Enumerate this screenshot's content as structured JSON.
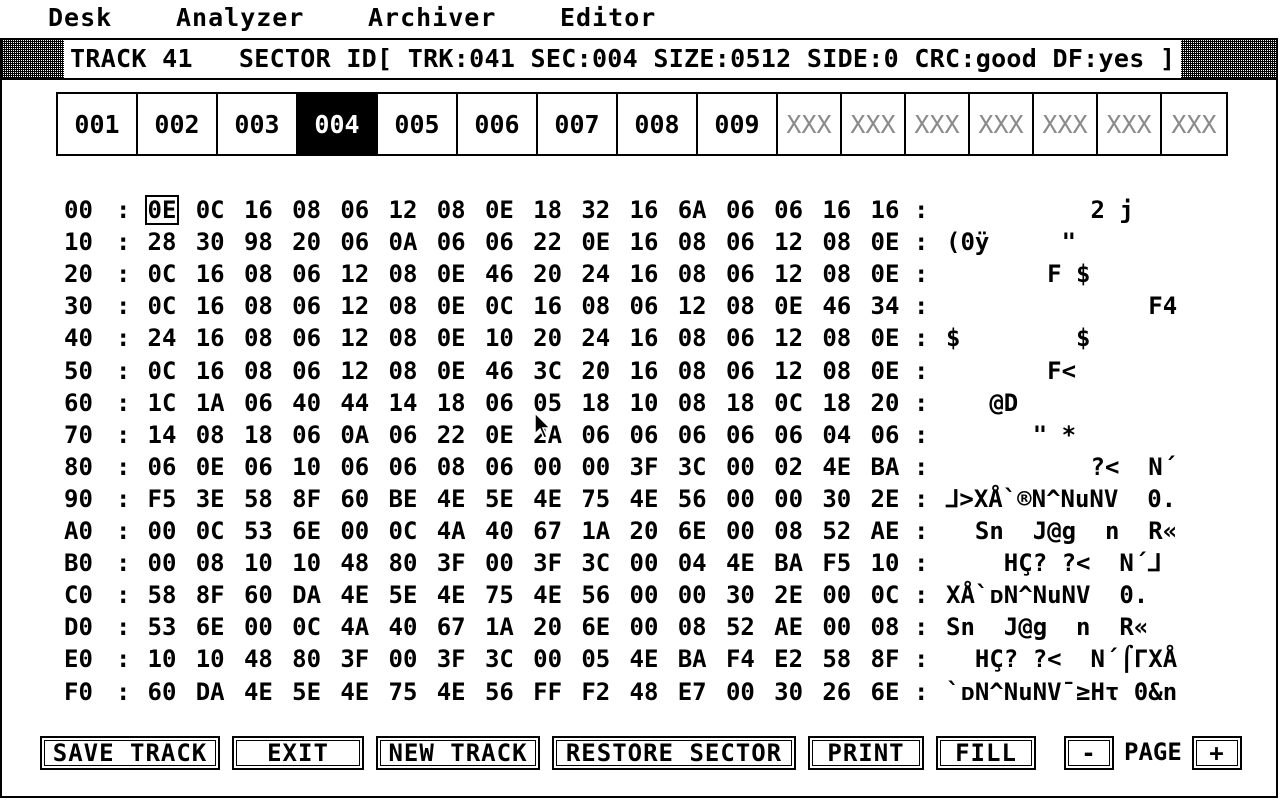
{
  "menubar": {
    "items": [
      "Desk",
      "Analyzer",
      "Archiver",
      "Editor"
    ]
  },
  "window": {
    "title": "TRACK 41   SECTOR ID[ TRK:041 SEC:004 SIZE:0512 SIDE:0 CRC:good DF:yes ]"
  },
  "sectors": {
    "selected": "004",
    "tabs": [
      "001",
      "002",
      "003",
      "004",
      "005",
      "006",
      "007",
      "008",
      "009",
      "XXX",
      "XXX",
      "XXX",
      "XXX",
      "XXX",
      "XXX",
      "XXX"
    ]
  },
  "dump": {
    "rows": [
      {
        "addr": "00",
        "bytes": [
          "0E",
          "0C",
          "16",
          "08",
          "06",
          "12",
          "08",
          "0E",
          "18",
          "32",
          "16",
          "6A",
          "06",
          "06",
          "16",
          "16"
        ],
        "ascii": "          2 j   "
      },
      {
        "addr": "10",
        "bytes": [
          "28",
          "30",
          "98",
          "20",
          "06",
          "0A",
          "06",
          "06",
          "22",
          "0E",
          "16",
          "08",
          "06",
          "12",
          "08",
          "0E"
        ],
        "ascii": "(0ÿ     \"       "
      },
      {
        "addr": "20",
        "bytes": [
          "0C",
          "16",
          "08",
          "06",
          "12",
          "08",
          "0E",
          "46",
          "20",
          "24",
          "16",
          "08",
          "06",
          "12",
          "08",
          "0E"
        ],
        "ascii": "       F $      "
      },
      {
        "addr": "30",
        "bytes": [
          "0C",
          "16",
          "08",
          "06",
          "12",
          "08",
          "0E",
          "0C",
          "16",
          "08",
          "06",
          "12",
          "08",
          "0E",
          "46",
          "34"
        ],
        "ascii": "              F4"
      },
      {
        "addr": "40",
        "bytes": [
          "24",
          "16",
          "08",
          "06",
          "12",
          "08",
          "0E",
          "10",
          "20",
          "24",
          "16",
          "08",
          "06",
          "12",
          "08",
          "0E"
        ],
        "ascii": "$        $      "
      },
      {
        "addr": "50",
        "bytes": [
          "0C",
          "16",
          "08",
          "06",
          "12",
          "08",
          "0E",
          "46",
          "3C",
          "20",
          "16",
          "08",
          "06",
          "12",
          "08",
          "0E"
        ],
        "ascii": "       F<       "
      },
      {
        "addr": "60",
        "bytes": [
          "1C",
          "1A",
          "06",
          "40",
          "44",
          "14",
          "18",
          "06",
          "05",
          "18",
          "10",
          "08",
          "18",
          "0C",
          "18",
          "20"
        ],
        "ascii": "   @D           "
      },
      {
        "addr": "70",
        "bytes": [
          "14",
          "08",
          "18",
          "06",
          "0A",
          "06",
          "22",
          "0E",
          "2A",
          "06",
          "06",
          "06",
          "06",
          "06",
          "04",
          "06"
        ],
        "ascii": "      \" *       "
      },
      {
        "addr": "80",
        "bytes": [
          "06",
          "0E",
          "06",
          "10",
          "06",
          "06",
          "08",
          "06",
          "00",
          "00",
          "3F",
          "3C",
          "00",
          "02",
          "4E",
          "BA"
        ],
        "ascii": "          ?<  N´"
      },
      {
        "addr": "90",
        "bytes": [
          "F5",
          "3E",
          "58",
          "8F",
          "60",
          "BE",
          "4E",
          "5E",
          "4E",
          "75",
          "4E",
          "56",
          "00",
          "00",
          "30",
          "2E"
        ],
        "ascii": "⅃>XÅ`®N^NuNV  0."
      },
      {
        "addr": "A0",
        "bytes": [
          "00",
          "0C",
          "53",
          "6E",
          "00",
          "0C",
          "4A",
          "40",
          "67",
          "1A",
          "20",
          "6E",
          "00",
          "08",
          "52",
          "AE"
        ],
        "ascii": "  Sn  J@g  n  R«"
      },
      {
        "addr": "B0",
        "bytes": [
          "00",
          "08",
          "10",
          "10",
          "48",
          "80",
          "3F",
          "00",
          "3F",
          "3C",
          "00",
          "04",
          "4E",
          "BA",
          "F5",
          "10"
        ],
        "ascii": "    HÇ? ?<  N´⅃ "
      },
      {
        "addr": "C0",
        "bytes": [
          "58",
          "8F",
          "60",
          "DA",
          "4E",
          "5E",
          "4E",
          "75",
          "4E",
          "56",
          "00",
          "00",
          "30",
          "2E",
          "00",
          "0C"
        ],
        "ascii": "XÅ`ᴅN^NuNV  0.  "
      },
      {
        "addr": "D0",
        "bytes": [
          "53",
          "6E",
          "00",
          "0C",
          "4A",
          "40",
          "67",
          "1A",
          "20",
          "6E",
          "00",
          "08",
          "52",
          "AE",
          "00",
          "08"
        ],
        "ascii": "Sn  J@g  n  R«  "
      },
      {
        "addr": "E0",
        "bytes": [
          "10",
          "10",
          "48",
          "80",
          "3F",
          "00",
          "3F",
          "3C",
          "00",
          "05",
          "4E",
          "BA",
          "F4",
          "E2",
          "58",
          "8F"
        ],
        "ascii": "  HÇ? ?<  N´⌠ΓXÅ"
      },
      {
        "addr": "F0",
        "bytes": [
          "60",
          "DA",
          "4E",
          "5E",
          "4E",
          "75",
          "4E",
          "56",
          "FF",
          "F2",
          "48",
          "E7",
          "00",
          "30",
          "26",
          "6E"
        ],
        "ascii": "`ᴅN^NuNV¯≥Hτ 0&n"
      }
    ]
  },
  "buttons": {
    "save_track": "SAVE TRACK",
    "exit": "EXIT",
    "new_track": "NEW TRACK",
    "restore_sector": "RESTORE SECTOR",
    "print": "PRINT",
    "fill": "FILL",
    "page_minus": "-",
    "page_label": "PAGE",
    "page_plus": "+"
  }
}
